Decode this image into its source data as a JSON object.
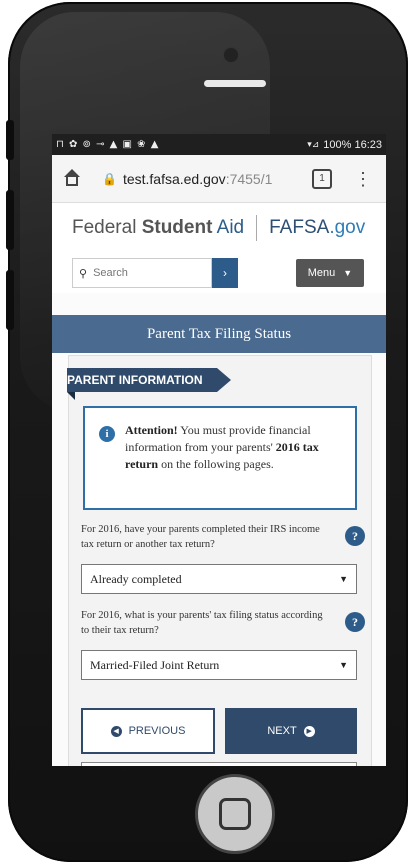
{
  "status_bar": {
    "left_icons": "⊓ ✿ ⊚ ⊸ ▲ ▣ ❀ ▲",
    "right": "100%  16:23",
    "signal": "▾⊿"
  },
  "browser": {
    "url_host": "test.fafsa.ed.gov",
    "url_path": ":7455/1",
    "tab_count": "1",
    "menu_glyph": "⋮"
  },
  "header": {
    "brand_federal": "Federal ",
    "brand_student": "Student",
    "brand_aid": " Aid",
    "brand_fafsa": "FAFSA",
    "brand_gov": ".gov",
    "search_placeholder": "Search",
    "search_go": "›",
    "menu_label": "Menu"
  },
  "page": {
    "title": "Parent Tax Filing Status"
  },
  "section": {
    "ribbon": "PARENT INFORMATION",
    "alert": {
      "lead": "Attention!",
      "text1": " You must provide financial information from your parents' ",
      "bold": "2016 tax return",
      "text2": " on the following pages."
    },
    "question1": "For 2016, have your parents completed their IRS income tax return or another tax return?",
    "answer1": "Already completed",
    "question2": "For 2016, what is your parents' tax filing status according to their tax return?",
    "answer2": "Married-Filed Joint Return",
    "help_glyph": "?"
  },
  "nav": {
    "previous": "PREVIOUS",
    "next": "NEXT"
  },
  "colors": {
    "brand_navy": "#2f4a6b",
    "title_bar": "#4a6a8f",
    "info_blue": "#2e6fa8"
  }
}
